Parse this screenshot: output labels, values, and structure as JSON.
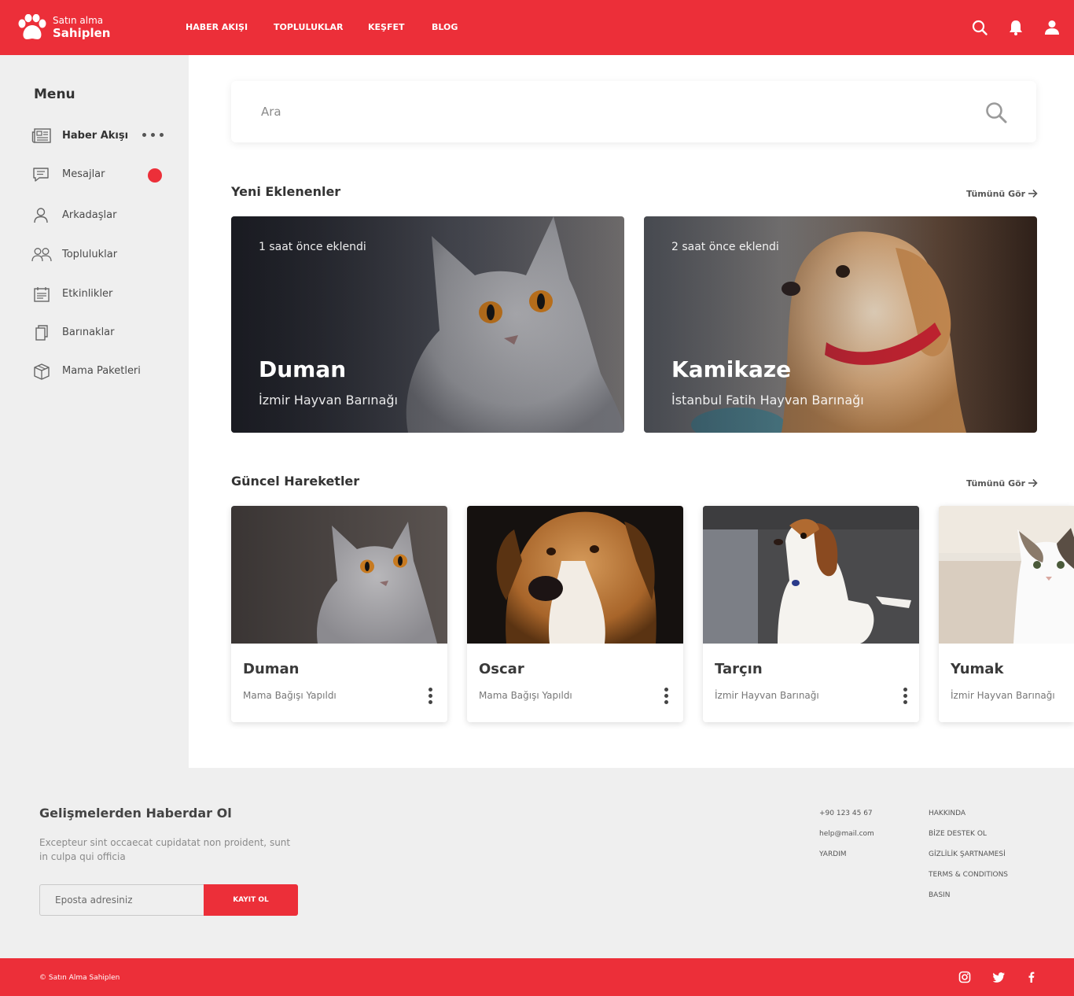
{
  "header": {
    "logo_top": "Satın alma",
    "logo_bottom": "Sahiplen",
    "nav": [
      "HABER AKIŞI",
      "TOPLULUKLAR",
      "KEŞFET",
      "BLOG"
    ]
  },
  "sidebar": {
    "title": "Menu",
    "items": [
      {
        "label": "Haber Akışı",
        "icon": "newspaper-icon"
      },
      {
        "label": "Mesajlar",
        "icon": "message-icon",
        "badge": ""
      },
      {
        "label": "Arkadaşlar",
        "icon": "user-icon"
      },
      {
        "label": "Topluluklar",
        "icon": "group-icon"
      },
      {
        "label": "Etkinlikler",
        "icon": "calendar-icon"
      },
      {
        "label": "Barınaklar",
        "icon": "copy-icon"
      },
      {
        "label": "Mama Paketleri",
        "icon": "box-icon"
      }
    ]
  },
  "search": {
    "placeholder": "Ara"
  },
  "new_added": {
    "title": "Yeni Eklenenler",
    "see_all": "Tümünü Gör",
    "items": [
      {
        "time": "1 saat önce eklendi",
        "name": "Duman",
        "location": "İzmir Hayvan Barınağı"
      },
      {
        "time": "2 saat önce eklendi",
        "name": "Kamikaze",
        "location": "İstanbul Fatih Hayvan Barınağı"
      }
    ]
  },
  "recent": {
    "title": "Güncel Hareketler",
    "see_all": "Tümünü Gör",
    "items": [
      {
        "name": "Duman",
        "subtitle": "Mama Bağışı Yapıldı"
      },
      {
        "name": "Oscar",
        "subtitle": "Mama Bağışı Yapıldı"
      },
      {
        "name": "Tarçın",
        "subtitle": "İzmir Hayvan Barınağı"
      },
      {
        "name": "Yumak",
        "subtitle": "İzmir Hayvan Barınağı"
      }
    ]
  },
  "footer": {
    "title": "Gelişmelerden Haberdar Ol",
    "desc": "Excepteur sint occaecat cupidatat non proident, sunt in culpa qui officia",
    "email_placeholder": "Eposta adresiniz",
    "button": "KAYIT OL",
    "contact": [
      "+90 123 45 67",
      "help@mail.com",
      "YARDIM"
    ],
    "links": [
      "HAKKINDA",
      "BİZE DESTEK OL",
      "GİZLİLİK ŞARTNAMESİ",
      "TERMS & CONDITIONS",
      "BASIN"
    ],
    "copyright": "© Satın Alma Sahiplen",
    "social": [
      "instagram-icon",
      "twitter-icon",
      "facebook-icon"
    ]
  },
  "colors": {
    "brand": "#ec2f39",
    "sidebar_bg": "#efefef"
  }
}
